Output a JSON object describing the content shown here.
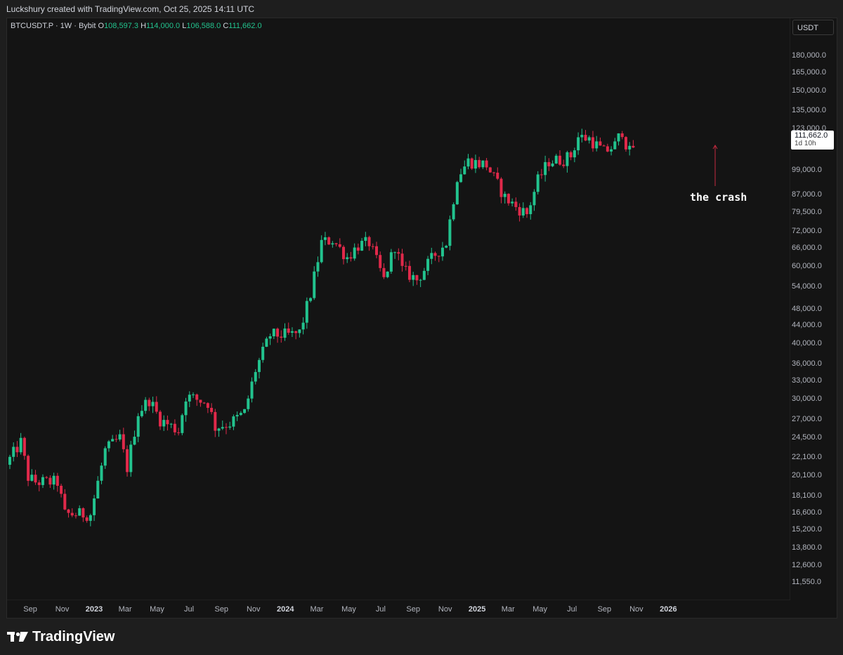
{
  "header": {
    "title": "Luckshury created with TradingView.com, Oct 25, 2025 14:11 UTC"
  },
  "legend": {
    "symbol": "BTCUSDT.P · 1W · Bybit",
    "o_label": "O",
    "o_value": "108,597.3",
    "h_label": "H",
    "h_value": "114,000.0",
    "l_label": "L",
    "l_value": "106,588.0",
    "c_label": "C",
    "c_value": "111,662.0"
  },
  "currency": "USDT",
  "last_price": {
    "value": "111,662.0",
    "countdown": "1d 10h"
  },
  "annotation": "the crash",
  "footer": {
    "brand": "TradingView"
  },
  "colors": {
    "up": "#22c38e",
    "down": "#e0294a",
    "bg": "#141414",
    "arrow": "#c62a3f"
  },
  "chart_data": {
    "type": "candlestick",
    "interval": "1W",
    "scale": "log",
    "ylim": [
      11000,
      190000
    ],
    "y_ticks": [
      "180,000.0",
      "165,000.0",
      "150,000.0",
      "135,000.0",
      "123,000.0",
      "99,000.0",
      "87,000.0",
      "79,500.0",
      "72,000.0",
      "66,000.0",
      "60,000.0",
      "54,000.0",
      "48,000.0",
      "44,000.0",
      "40,000.0",
      "36,000.0",
      "33,000.0",
      "30,000.0",
      "27,000.0",
      "24,500.0",
      "22,100.0",
      "20,100.0",
      "18,100.0",
      "16,600.0",
      "15,200.0",
      "13,800.0",
      "12,600.0",
      "11,550.0"
    ],
    "x_ticks": [
      {
        "label": "Sep",
        "year": false
      },
      {
        "label": "Nov",
        "year": false
      },
      {
        "label": "2023",
        "year": true
      },
      {
        "label": "Mar",
        "year": false
      },
      {
        "label": "May",
        "year": false
      },
      {
        "label": "Jul",
        "year": false
      },
      {
        "label": "Sep",
        "year": false
      },
      {
        "label": "Nov",
        "year": false
      },
      {
        "label": "2024",
        "year": true
      },
      {
        "label": "Mar",
        "year": false
      },
      {
        "label": "May",
        "year": false
      },
      {
        "label": "Jul",
        "year": false
      },
      {
        "label": "Sep",
        "year": false
      },
      {
        "label": "Nov",
        "year": false
      },
      {
        "label": "2025",
        "year": true
      },
      {
        "label": "Mar",
        "year": false
      },
      {
        "label": "May",
        "year": false
      },
      {
        "label": "Jul",
        "year": false
      },
      {
        "label": "Sep",
        "year": false
      },
      {
        "label": "Nov",
        "year": false
      },
      {
        "label": "2026",
        "year": true
      }
    ],
    "anchors": [
      [
        "2022-07-24",
        22000
      ],
      [
        "2022-08-14",
        24000
      ],
      [
        "2022-08-28",
        20000
      ],
      [
        "2022-09-11",
        19500
      ],
      [
        "2022-10-23",
        19500
      ],
      [
        "2022-11-06",
        16500
      ],
      [
        "2022-12-25",
        16500
      ],
      [
        "2023-01-22",
        23000
      ],
      [
        "2023-02-19",
        24500
      ],
      [
        "2023-03-05",
        21000
      ],
      [
        "2023-03-26",
        28000
      ],
      [
        "2023-04-16",
        30000
      ],
      [
        "2023-05-07",
        27000
      ],
      [
        "2023-06-11",
        25500
      ],
      [
        "2023-06-25",
        30500
      ],
      [
        "2023-08-06",
        29500
      ],
      [
        "2023-08-20",
        26000
      ],
      [
        "2023-09-17",
        26500
      ],
      [
        "2023-10-15",
        28000
      ],
      [
        "2023-11-05",
        35000
      ],
      [
        "2023-12-03",
        42000
      ],
      [
        "2024-01-14",
        42000
      ],
      [
        "2024-01-28",
        42500
      ],
      [
        "2024-02-18",
        52000
      ],
      [
        "2024-03-10",
        68000
      ],
      [
        "2024-03-31",
        69000
      ],
      [
        "2024-04-28",
        63000
      ],
      [
        "2024-05-19",
        67000
      ],
      [
        "2024-06-09",
        68000
      ],
      [
        "2024-07-07",
        56000
      ],
      [
        "2024-07-28",
        67000
      ],
      [
        "2024-08-11",
        59000
      ],
      [
        "2024-09-08",
        56000
      ],
      [
        "2024-10-13",
        64000
      ],
      [
        "2024-11-03",
        68000
      ],
      [
        "2024-11-24",
        96000
      ],
      [
        "2024-12-15",
        104000
      ],
      [
        "2025-01-19",
        102000
      ],
      [
        "2025-02-23",
        86000
      ],
      [
        "2025-03-16",
        82000
      ],
      [
        "2025-04-06",
        79000
      ],
      [
        "2025-04-27",
        94000
      ],
      [
        "2025-05-18",
        104000
      ],
      [
        "2025-06-15",
        105000
      ],
      [
        "2025-06-29",
        107000
      ],
      [
        "2025-07-13",
        118000
      ],
      [
        "2025-08-03",
        117000
      ],
      [
        "2025-08-31",
        109000
      ],
      [
        "2025-09-21",
        113000
      ],
      [
        "2025-10-05",
        122000
      ],
      [
        "2025-10-12",
        114000
      ],
      [
        "2025-10-19",
        109000
      ],
      [
        "2025-10-26",
        111662
      ]
    ]
  }
}
